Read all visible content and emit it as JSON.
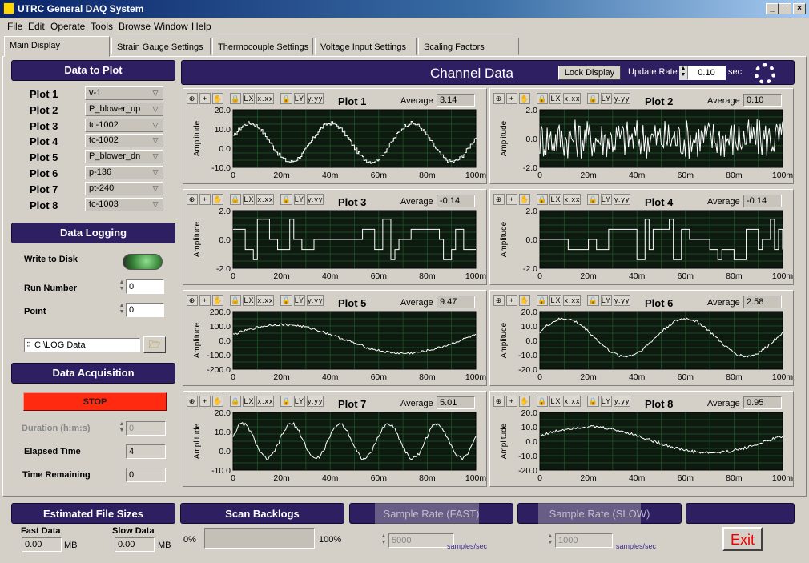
{
  "window": {
    "title": "UTRC General DAQ System"
  },
  "menu": [
    "File",
    "Edit",
    "Operate",
    "Tools",
    "Browse",
    "Window",
    "Help"
  ],
  "tabs": [
    "Main Display",
    "Strain Gauge Settings",
    "Thermocouple Settings",
    "Voltage Input Settings",
    "Scaling Factors"
  ],
  "data_to_plot": {
    "header": "Data to Plot",
    "plots": [
      {
        "label": "Plot 1",
        "channel": "v-1"
      },
      {
        "label": "Plot 2",
        "channel": "P_blower_up"
      },
      {
        "label": "Plot 3",
        "channel": "tc-1002"
      },
      {
        "label": "Plot 4",
        "channel": "tc-1002"
      },
      {
        "label": "Plot 5",
        "channel": "P_blower_dn"
      },
      {
        "label": "Plot 6",
        "channel": "p-136"
      },
      {
        "label": "Plot 7",
        "channel": "pt-240"
      },
      {
        "label": "Plot 8",
        "channel": "tc-1003"
      }
    ]
  },
  "logging": {
    "header": "Data Logging",
    "write_label": "Write to Disk",
    "run_label": "Run Number",
    "run_value": "0",
    "point_label": "Point",
    "point_value": "0",
    "path": "C:\\LOG Data"
  },
  "acq": {
    "header": "Data Acquisition",
    "stop_label": "STOP",
    "duration_label": "Duration (h:m:s)",
    "duration_value": "0",
    "elapsed_label": "Elapsed Time",
    "elapsed_value": "4",
    "remaining_label": "Time Remaining",
    "remaining_value": "0"
  },
  "channel": {
    "header": "Channel Data",
    "lock_label": "Lock Display",
    "rate_label": "Update Rate",
    "rate_value": "0.10",
    "rate_unit": "sec"
  },
  "graphs": [
    {
      "title": "Plot 1",
      "avg": "3.14",
      "ylabel": "Amplitude",
      "yticks": [
        "20.0",
        "10.0",
        "0.0",
        "-10.0"
      ],
      "ylim": [
        -10,
        20
      ],
      "shape": "sine",
      "amp": 10,
      "offset": 3,
      "cycles": 3,
      "noise": 1,
      "step": true
    },
    {
      "title": "Plot 2",
      "avg": "0.10",
      "ylabel": "Amplitude",
      "yticks": [
        "2.0",
        "0.0",
        "-2.0"
      ],
      "ylim": [
        -2,
        2
      ],
      "shape": "noise",
      "amp": 1.4,
      "offset": 0,
      "cycles": 0,
      "noise": 1.4,
      "step": false
    },
    {
      "title": "Plot 3",
      "avg": "-0.14",
      "ylabel": "Amplitude",
      "yticks": [
        "2.0",
        "0.0",
        "-2.0"
      ],
      "ylim": [
        -2,
        2
      ],
      "shape": "square",
      "amp": 1.4,
      "offset": 0,
      "cycles": 0,
      "noise": 0,
      "step": true
    },
    {
      "title": "Plot 4",
      "avg": "-0.14",
      "ylabel": "Amplitude",
      "yticks": [
        "2.0",
        "0.0",
        "-2.0"
      ],
      "ylim": [
        -2,
        2
      ],
      "shape": "square",
      "amp": 1.4,
      "offset": 0,
      "cycles": 0,
      "noise": 0,
      "step": true
    },
    {
      "title": "Plot 5",
      "avg": "9.47",
      "ylabel": "Amplitude",
      "yticks": [
        "200.0",
        "100.0",
        "0.0",
        "-100.0",
        "-200.0"
      ],
      "ylim": [
        -200,
        200
      ],
      "shape": "sine",
      "amp": 100,
      "offset": 10,
      "cycles": 1,
      "noise": 8,
      "step": false
    },
    {
      "title": "Plot 6",
      "avg": "2.58",
      "ylabel": "Amplitude",
      "yticks": [
        "20.0",
        "10.0",
        "0.0",
        "-10.0",
        "-20.0"
      ],
      "ylim": [
        -20,
        20
      ],
      "shape": "sine",
      "amp": 13,
      "offset": 2,
      "cycles": 2,
      "noise": 1,
      "step": false
    },
    {
      "title": "Plot 7",
      "avg": "5.01",
      "ylabel": "Amplitude",
      "yticks": [
        "20.0",
        "10.0",
        "0.0",
        "-10.0"
      ],
      "ylim": [
        -10,
        20
      ],
      "shape": "sine",
      "amp": 9,
      "offset": 5,
      "cycles": 5,
      "noise": 1,
      "step": false
    },
    {
      "title": "Plot 8",
      "avg": "0.95",
      "ylabel": "Amplitude",
      "yticks": [
        "20.0",
        "10.0",
        "0.0",
        "-10.0",
        "-20.0"
      ],
      "ylim": [
        -20,
        20
      ],
      "shape": "sine",
      "amp": 9,
      "offset": 1,
      "cycles": 1,
      "noise": 1,
      "step": false
    }
  ],
  "xticks": [
    "0",
    "20m",
    "40m",
    "60m",
    "80m",
    "100m"
  ],
  "file_sizes": {
    "header": "Estimated File Sizes",
    "fast_label": "Fast Data",
    "fast_value": "0.00",
    "fast_unit": "MB",
    "slow_label": "Slow Data",
    "slow_value": "0.00",
    "slow_unit": "MB"
  },
  "backlogs": {
    "header": "Scan Backlogs",
    "min": "0%",
    "max": "100%",
    "progress": 0
  },
  "fast_rate": {
    "header": "Sample Rate (FAST)",
    "value": "5000",
    "unit": "samples/sec"
  },
  "slow_rate": {
    "header": "Sample Rate (SLOW)",
    "value": "1000",
    "unit": "samples/sec"
  },
  "exit_label": "Exit"
}
